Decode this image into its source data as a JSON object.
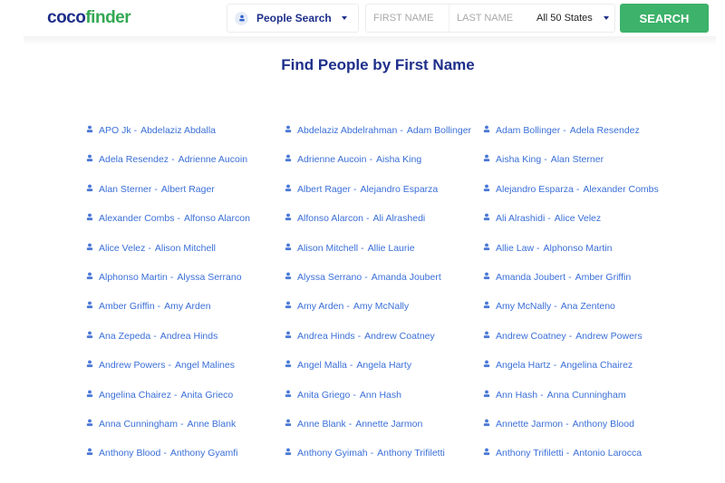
{
  "header": {
    "logo_part1": "coco",
    "logo_part2": "finder",
    "search_type": "People Search",
    "first_name_placeholder": "FIRST NAME",
    "last_name_placeholder": "LAST NAME",
    "state": "All 50 States",
    "search_button": "SEARCH"
  },
  "colors": {
    "brand_navy": "#1e2f8a",
    "brand_green": "#33a852",
    "button_green": "#3cb26a",
    "link_blue": "#3a6fd8"
  },
  "page_title": "Find People by First Name",
  "columns": [
    [
      {
        "from": "APO Jk",
        "to": "Abdelaziz Abdalla"
      },
      {
        "from": "Adela Resendez",
        "to": "Adrienne Aucoin"
      },
      {
        "from": "Alan Sterner",
        "to": "Albert Rager"
      },
      {
        "from": "Alexander Combs",
        "to": "Alfonso Alarcon"
      },
      {
        "from": "Alice Velez",
        "to": "Alison Mitchell"
      },
      {
        "from": "Alphonso Martin",
        "to": "Alyssa Serrano"
      },
      {
        "from": "Amber Griffin",
        "to": "Amy Arden"
      },
      {
        "from": "Ana Zepeda",
        "to": "Andrea Hinds"
      },
      {
        "from": "Andrew Powers",
        "to": "Angel Malines"
      },
      {
        "from": "Angelina Chairez",
        "to": "Anita Grieco"
      },
      {
        "from": "Anna Cunningham",
        "to": "Anne Blank"
      },
      {
        "from": "Anthony Blood",
        "to": "Anthony Gyamfi"
      }
    ],
    [
      {
        "from": "Abdelaziz Abdelrahman",
        "to": "Adam Bollinger"
      },
      {
        "from": "Adrienne Aucoin",
        "to": "Aisha King"
      },
      {
        "from": "Albert Rager",
        "to": "Alejandro Esparza"
      },
      {
        "from": "Alfonso Alarcon",
        "to": "Ali Alrashedi"
      },
      {
        "from": "Alison Mitchell",
        "to": "Allie Laurie"
      },
      {
        "from": "Alyssa Serrano",
        "to": "Amanda Joubert"
      },
      {
        "from": "Amy Arden",
        "to": "Amy McNally"
      },
      {
        "from": "Andrea Hinds",
        "to": "Andrew Coatney"
      },
      {
        "from": "Angel Malla",
        "to": "Angela Harty"
      },
      {
        "from": "Anita Griego",
        "to": "Ann Hash"
      },
      {
        "from": "Anne Blank",
        "to": "Annette Jarmon"
      },
      {
        "from": "Anthony Gyimah",
        "to": "Anthony Trifiletti"
      }
    ],
    [
      {
        "from": "Adam Bollinger",
        "to": "Adela Resendez"
      },
      {
        "from": "Aisha King",
        "to": "Alan Sterner"
      },
      {
        "from": "Alejandro Esparza",
        "to": "Alexander Combs"
      },
      {
        "from": "Ali Alrashidi",
        "to": "Alice Velez"
      },
      {
        "from": "Allie Law",
        "to": "Alphonso Martin"
      },
      {
        "from": "Amanda Joubert",
        "to": "Amber Griffin"
      },
      {
        "from": "Amy McNally",
        "to": "Ana Zenteno"
      },
      {
        "from": "Andrew Coatney",
        "to": "Andrew Powers"
      },
      {
        "from": "Angela Hartz",
        "to": "Angelina Chairez"
      },
      {
        "from": "Ann Hash",
        "to": "Anna Cunningham"
      },
      {
        "from": "Annette Jarmon",
        "to": "Anthony Blood"
      },
      {
        "from": "Anthony Trifiletti",
        "to": "Antonio Larocca"
      }
    ]
  ],
  "separator": "-"
}
